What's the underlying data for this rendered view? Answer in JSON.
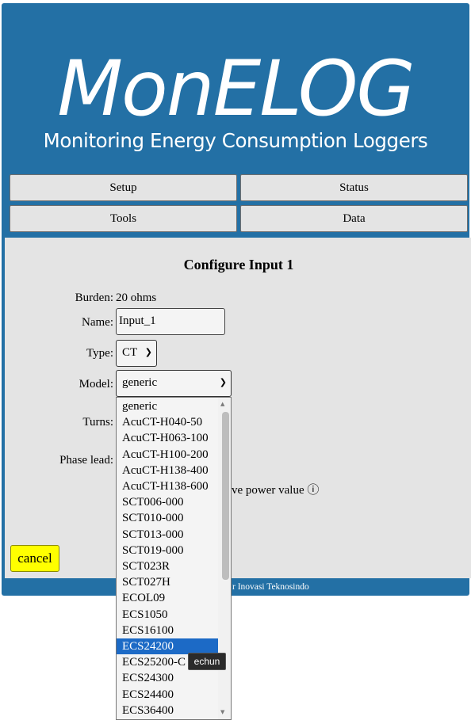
{
  "header": {
    "logo": "MonELOG",
    "tagline": "Monitoring Energy Consumption Loggers"
  },
  "nav": {
    "setup": "Setup",
    "status": "Status",
    "tools": "Tools",
    "data": "Data"
  },
  "form": {
    "title": "Configure Input 1",
    "burden_label": "Burden:",
    "burden_value": "20 ohms",
    "name_label": "Name:",
    "name_value": "Input_1",
    "type_label": "Type:",
    "type_value": "CT",
    "model_label": "Model:",
    "model_value": "generic",
    "turns_label": "Turns:",
    "phase_lead_label": "Phase lead:",
    "power_partial": "ve power value ⓘ",
    "cancel": "cancel"
  },
  "footer": {
    "partial_text": "r Inovasi Teknosindo"
  },
  "dropdown": {
    "options": [
      "generic",
      "AcuCT-H040-50",
      "AcuCT-H063-100",
      "AcuCT-H100-200",
      "AcuCT-H138-400",
      "AcuCT-H138-600",
      "SCT006-000",
      "SCT010-000",
      "SCT013-000",
      "SCT019-000",
      "SCT023R",
      "SCT027H",
      "ECOL09",
      "ECS1050",
      "ECS16100",
      "ECS24200",
      "ECS25200-C",
      "ECS24300",
      "ECS24400",
      "ECS36400"
    ],
    "highlighted": "ECS24200",
    "tooltip": "echun"
  },
  "colors": {
    "brand_blue": "#2370a5",
    "panel_gray": "#e4e4e4",
    "cancel_yellow": "#ffff00",
    "highlight_blue": "#1c6ac6"
  }
}
